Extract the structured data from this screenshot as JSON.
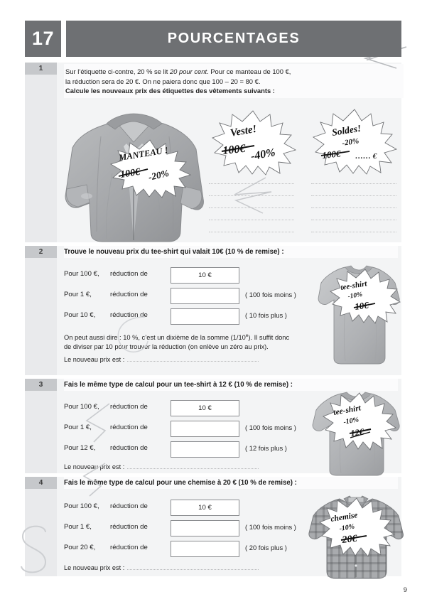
{
  "header": {
    "chapter_number": "17",
    "title": "POURCENTAGES",
    "bar_color": "#6e7073"
  },
  "page_number": "9",
  "exercises": [
    {
      "number": "1",
      "prompt_line1_a": "Sur l’étiquette ci-contre, 20 % se lit ",
      "prompt_line1_i": "20 pour cent",
      "prompt_line1_b": ". Pour ce manteau de 100 €,",
      "prompt_line2": "la réduction sera de 20 €. On ne paiera donc que 100 – 20 = 80 €.",
      "prompt_line3": "Calcule les nouveaux prix des étiquettes des vêtements suivants :"
    },
    {
      "number": "2",
      "title": "Trouve le nouveau prix du tee-shirt qui valait 10€  (10 % de remise) :",
      "rows": [
        {
          "left": "Pour 100 €,",
          "mid": "réduction de",
          "value": "10 €",
          "note": ""
        },
        {
          "left": "Pour 1 €,",
          "mid": "réduction de",
          "value": "",
          "note": "( 100 fois moins )"
        },
        {
          "left": "Pour 10 €,",
          "mid": "réduction de",
          "value": "",
          "note": "( 10 fois plus )"
        }
      ],
      "explanation_line1": "On peut aussi dire : 10 %, c’est un dixième de la somme (1/10",
      "explanation_sup": "e",
      "explanation_line1b": "). Il suffit donc",
      "explanation_line2": "de diviser par 10 pour trouver la réduction (on enlève un zéro au prix).",
      "final_label": "Le nouveau prix est :"
    },
    {
      "number": "3",
      "title": "Fais le même type de calcul pour un tee-shirt à 12 € (10 % de remise) :",
      "rows": [
        {
          "left": "Pour 100 €,",
          "mid": "réduction de",
          "value": "10 €",
          "note": ""
        },
        {
          "left": "Pour 1 €,",
          "mid": "réduction de",
          "value": "",
          "note": "( 100 fois moins )"
        },
        {
          "left": "Pour 12 €,",
          "mid": "réduction de",
          "value": "",
          "note": "( 12 fois plus )"
        }
      ],
      "final_label": "Le nouveau prix est :"
    },
    {
      "number": "4",
      "title": "Fais le même type de calcul pour une chemise à 20 €  (10 % de remise) :",
      "rows": [
        {
          "left": "Pour 100 €,",
          "mid": "réduction de",
          "value": "10 €",
          "note": ""
        },
        {
          "left": "Pour 1 €,",
          "mid": "réduction de",
          "value": "",
          "note": "( 100 fois moins )"
        },
        {
          "left": "Pour 20 €,",
          "mid": "réduction de",
          "value": "",
          "note": "( 20 fois plus )"
        }
      ],
      "final_label": "Le nouveau prix est :"
    }
  ],
  "price_tags": {
    "coat": {
      "name": "MANTEAU !",
      "price": "100€",
      "discount": "-20%"
    },
    "jacket": {
      "name": "Veste!",
      "price": "100€",
      "discount": "-40%"
    },
    "sale": {
      "name": "Soldes!",
      "discount": "-20%",
      "price": "100€",
      "blank": "…… €"
    },
    "tshirt1": {
      "name": "tee-shirt",
      "discount": "-10%",
      "price": "10€"
    },
    "tshirt2": {
      "name": "tee-shirt",
      "discount": "-10%",
      "price": "12€"
    },
    "shirt": {
      "name": "chemise",
      "discount": "-10%",
      "price": "20€"
    }
  }
}
